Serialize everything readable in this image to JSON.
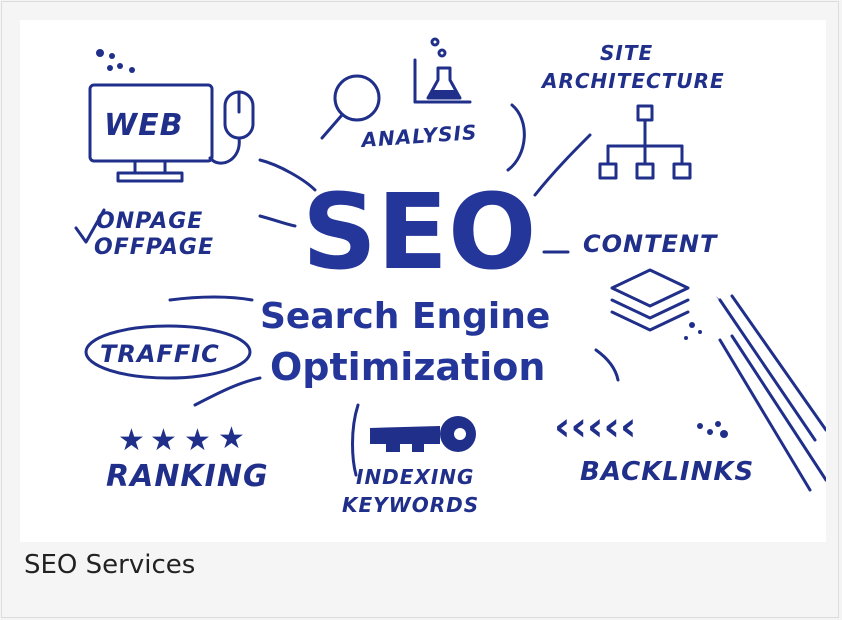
{
  "image": {
    "words": {
      "web": "WEB",
      "analysis": "ANALYSIS",
      "site": "SITE",
      "architecture": "ARCHITECTURE",
      "onpage": "ONPAGE",
      "offpage": "OFFPAGE",
      "seo": "SEO",
      "content": "CONTENT",
      "search_engine": "Search Engine",
      "optimization": "Optimization",
      "traffic": "TRAFFIC",
      "ranking": "RANKING",
      "indexing": "INDEXING",
      "keywords": "KEYWORDS",
      "backlinks": "BACKLINKS"
    },
    "ink_color": "#1f2f8a"
  },
  "caption": "SEO Services"
}
